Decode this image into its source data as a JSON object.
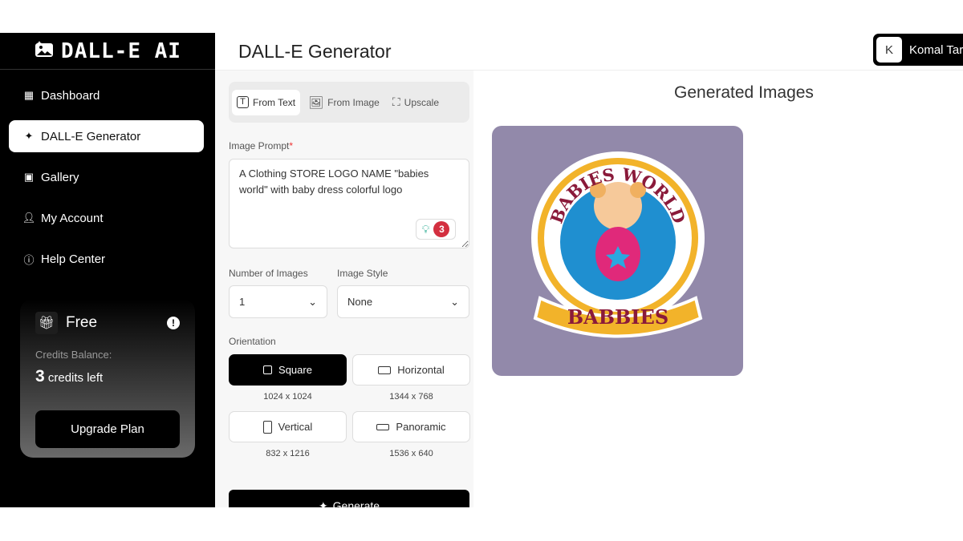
{
  "sidebar": {
    "brand": "DALL-E AI",
    "items": [
      {
        "label": "Dashboard",
        "icon": "grid-icon"
      },
      {
        "label": "DALL-E Generator",
        "icon": "sparkle-icon",
        "active": true
      },
      {
        "label": "Gallery",
        "icon": "image-icon"
      },
      {
        "label": "My Account",
        "icon": "user-icon"
      },
      {
        "label": "Help Center",
        "icon": "info-icon"
      }
    ],
    "plan": {
      "name": "Free",
      "credits_label": "Credits Balance:",
      "credits_count": "3",
      "credits_suffix": "credits left",
      "upgrade_label": "Upgrade Plan"
    }
  },
  "header": {
    "title": "DALL-E Generator",
    "user_initial": "K",
    "user_name": "Komal Tar"
  },
  "form": {
    "tabs": [
      {
        "label": "From Text",
        "active": true
      },
      {
        "label": "From Image"
      },
      {
        "label": "Upscale"
      }
    ],
    "prompt_label": "Image Prompt",
    "required_mark": "*",
    "prompt_value": "A Clothing STORE LOGO NAME \"babies world\" with baby dress colorful logo",
    "grammar_count": "3",
    "num_images_label": "Number of Images",
    "num_images_value": "1",
    "style_label": "Image Style",
    "style_value": "None",
    "orientation_label": "Orientation",
    "orientations": [
      {
        "label": "Square",
        "size": "1024 x 1024",
        "active": true
      },
      {
        "label": "Horizontal",
        "size": "1344 x 768"
      },
      {
        "label": "Vertical",
        "size": "832 x 1216"
      },
      {
        "label": "Panoramic",
        "size": "1536 x 640"
      }
    ],
    "generate_label": "Generate"
  },
  "results": {
    "title": "Generated Images",
    "logo_text_top": "BABIES WORLD",
    "logo_text_bottom": "BABBIES"
  },
  "colors": {
    "accent": "#000000",
    "panel": "#f7f7f7",
    "image_bg": "#9289aa",
    "grammar_badge": "#d32f3f"
  }
}
